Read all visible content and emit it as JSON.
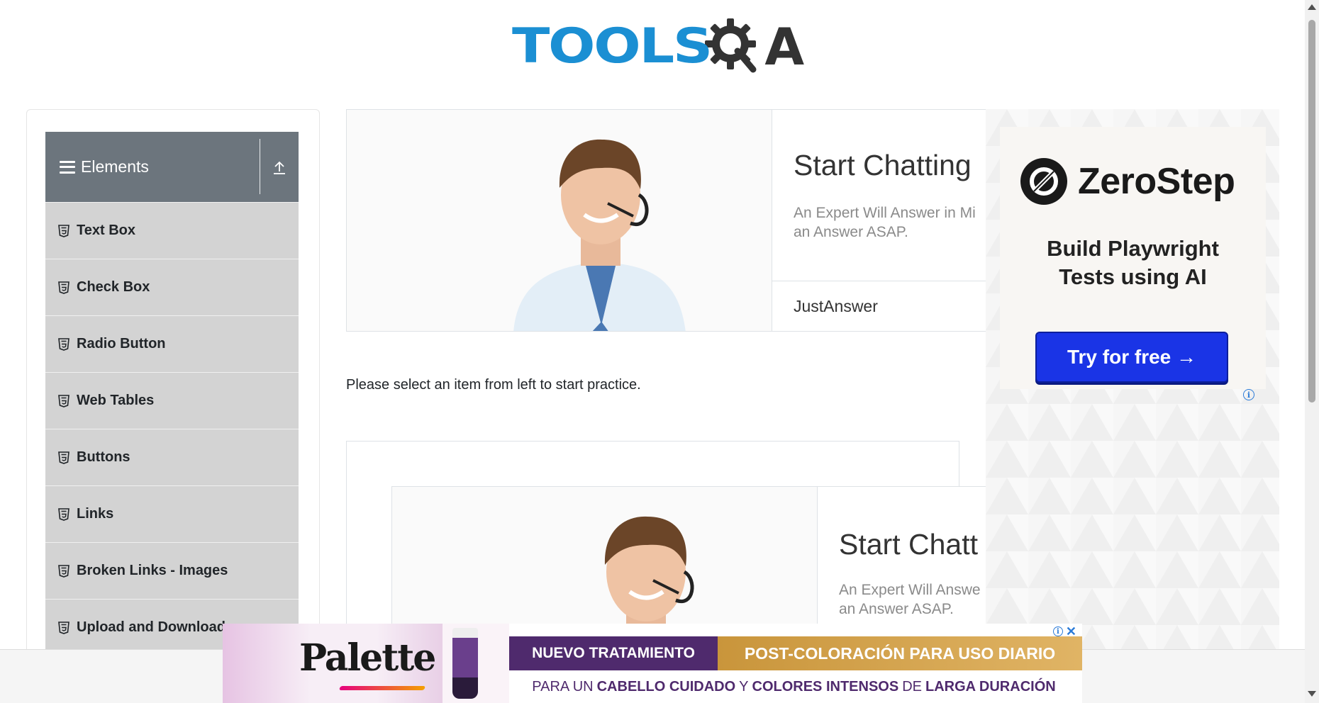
{
  "header": {
    "logo_text": "TOOLS",
    "logo_suffix": "A"
  },
  "sidebar": {
    "group_title": "Elements",
    "items": [
      {
        "label": "Text Box"
      },
      {
        "label": "Check Box"
      },
      {
        "label": "Radio Button"
      },
      {
        "label": "Web Tables"
      },
      {
        "label": "Buttons"
      },
      {
        "label": "Links"
      },
      {
        "label": "Broken Links - Images"
      },
      {
        "label": "Upload and Download"
      }
    ]
  },
  "main": {
    "ad_top": {
      "heading": "Start Chatting",
      "description_line1": "An Expert Will Answer in Mi",
      "description_line2": "an Answer ASAP.",
      "brand": "JustAnswer"
    },
    "practice_text": "Please select an item from left to start practice.",
    "ad_bottom": {
      "heading": "Start Chatt",
      "description_line1": "An Expert Will Answe",
      "description_line2": "an Answer ASAP."
    }
  },
  "side_ad": {
    "brand": "ZeroStep",
    "tagline_line1": "Build Playwright",
    "tagline_line2": "Tests using AI",
    "cta": "Try for free →",
    "info_icon": "i"
  },
  "bottom_ad": {
    "brand": "Palette",
    "badge_left": "NUEVO TRATAMIENTO",
    "badge_right": "POST-COLORACIÓN PARA USO DIARIO",
    "line_part1": "PARA UN",
    "line_part2": "CABELLO CUIDADO",
    "line_part3": "Y",
    "line_part4": "COLORES INTENSOS",
    "line_part5": "DE",
    "line_part6": "LARGA DURACIÓN",
    "info_icon": "i",
    "close_icon": "✕"
  },
  "colors": {
    "accent": "#1b8fd3",
    "sidebar_header": "#6c757d",
    "menu_item": "#d3d3d3",
    "cta_blue": "#1a34e6",
    "palette_purple": "#4f2a6d"
  }
}
